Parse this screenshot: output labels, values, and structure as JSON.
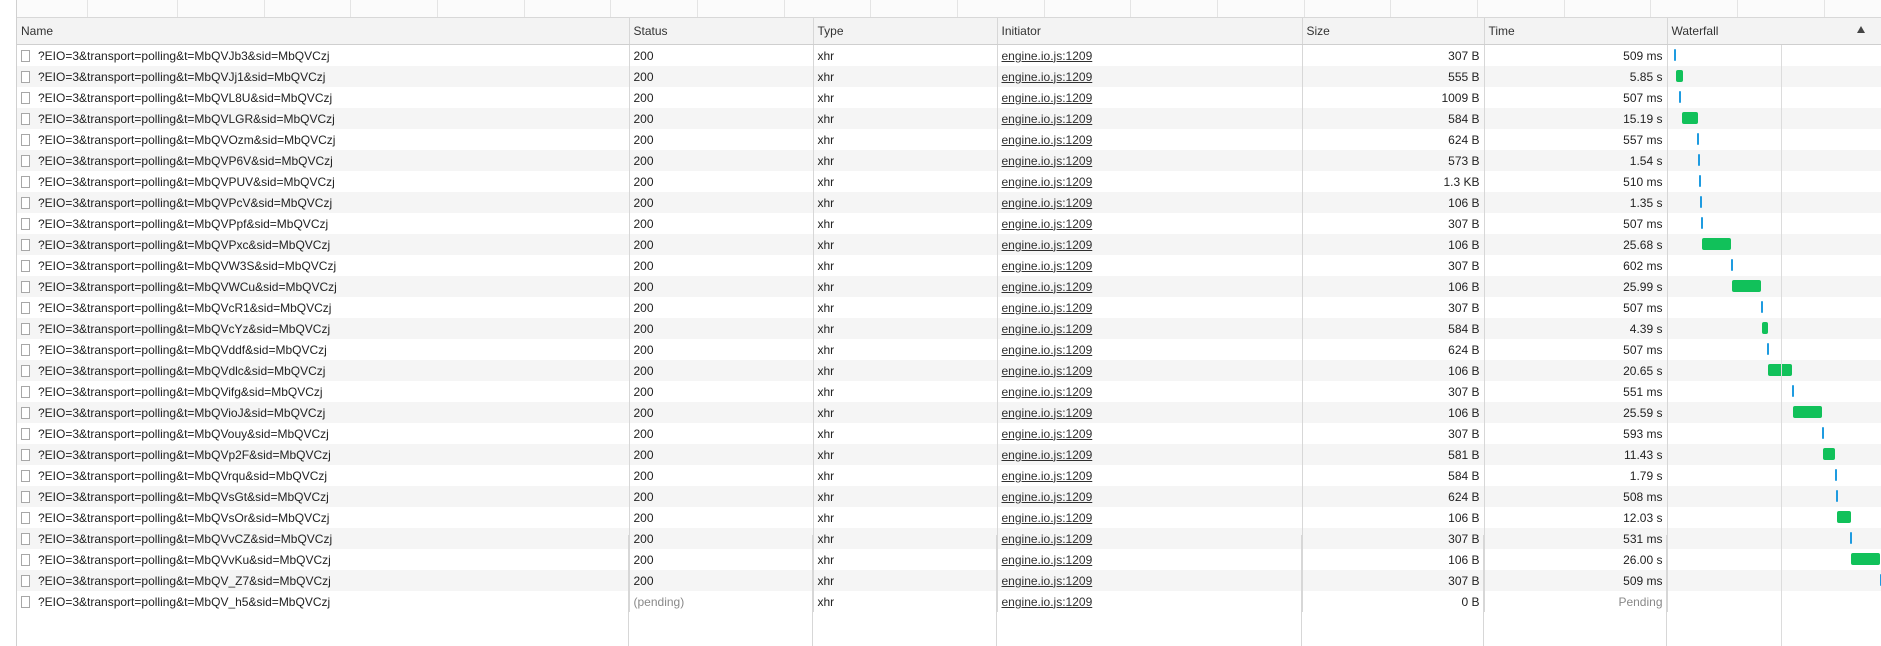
{
  "columns": {
    "name": "Name",
    "status": "Status",
    "type": "Type",
    "initiator": "Initiator",
    "size": "Size",
    "time": "Time",
    "waterfall": "Waterfall"
  },
  "waterfall_sort": "ascending",
  "colors": {
    "bar_receiving": "#11c15a",
    "bar_waiting": "#1e9be0",
    "row_alt": "#f5f5f5",
    "header_bg": "#f3f3f3"
  },
  "rows": [
    {
      "name": "?EIO=3&transport=polling&t=MbQVJb3&sid=MbQVCzj",
      "status": "200",
      "type": "xhr",
      "initiator": "engine.io.js:1209",
      "size": "307 B",
      "time": "509 ms"
    },
    {
      "name": "?EIO=3&transport=polling&t=MbQVJj1&sid=MbQVCzj",
      "status": "200",
      "type": "xhr",
      "initiator": "engine.io.js:1209",
      "size": "555 B",
      "time": "5.85 s"
    },
    {
      "name": "?EIO=3&transport=polling&t=MbQVL8U&sid=MbQVCzj",
      "status": "200",
      "type": "xhr",
      "initiator": "engine.io.js:1209",
      "size": "1009 B",
      "time": "507 ms"
    },
    {
      "name": "?EIO=3&transport=polling&t=MbQVLGR&sid=MbQVCzj",
      "status": "200",
      "type": "xhr",
      "initiator": "engine.io.js:1209",
      "size": "584 B",
      "time": "15.19 s"
    },
    {
      "name": "?EIO=3&transport=polling&t=MbQVOzm&sid=MbQVCzj",
      "status": "200",
      "type": "xhr",
      "initiator": "engine.io.js:1209",
      "size": "624 B",
      "time": "557 ms"
    },
    {
      "name": "?EIO=3&transport=polling&t=MbQVP6V&sid=MbQVCzj",
      "status": "200",
      "type": "xhr",
      "initiator": "engine.io.js:1209",
      "size": "573 B",
      "time": "1.54 s"
    },
    {
      "name": "?EIO=3&transport=polling&t=MbQVPUV&sid=MbQVCzj",
      "status": "200",
      "type": "xhr",
      "initiator": "engine.io.js:1209",
      "size": "1.3 KB",
      "time": "510 ms"
    },
    {
      "name": "?EIO=3&transport=polling&t=MbQVPcV&sid=MbQVCzj",
      "status": "200",
      "type": "xhr",
      "initiator": "engine.io.js:1209",
      "size": "106 B",
      "time": "1.35 s"
    },
    {
      "name": "?EIO=3&transport=polling&t=MbQVPpf&sid=MbQVCzj",
      "status": "200",
      "type": "xhr",
      "initiator": "engine.io.js:1209",
      "size": "307 B",
      "time": "507 ms"
    },
    {
      "name": "?EIO=3&transport=polling&t=MbQVPxc&sid=MbQVCzj",
      "status": "200",
      "type": "xhr",
      "initiator": "engine.io.js:1209",
      "size": "106 B",
      "time": "25.68 s"
    },
    {
      "name": "?EIO=3&transport=polling&t=MbQVW3S&sid=MbQVCzj",
      "status": "200",
      "type": "xhr",
      "initiator": "engine.io.js:1209",
      "size": "307 B",
      "time": "602 ms"
    },
    {
      "name": "?EIO=3&transport=polling&t=MbQVWCu&sid=MbQVCzj",
      "status": "200",
      "type": "xhr",
      "initiator": "engine.io.js:1209",
      "size": "106 B",
      "time": "25.99 s"
    },
    {
      "name": "?EIO=3&transport=polling&t=MbQVcR1&sid=MbQVCzj",
      "status": "200",
      "type": "xhr",
      "initiator": "engine.io.js:1209",
      "size": "307 B",
      "time": "507 ms"
    },
    {
      "name": "?EIO=3&transport=polling&t=MbQVcYz&sid=MbQVCzj",
      "status": "200",
      "type": "xhr",
      "initiator": "engine.io.js:1209",
      "size": "584 B",
      "time": "4.39 s"
    },
    {
      "name": "?EIO=3&transport=polling&t=MbQVddf&sid=MbQVCzj",
      "status": "200",
      "type": "xhr",
      "initiator": "engine.io.js:1209",
      "size": "624 B",
      "time": "507 ms"
    },
    {
      "name": "?EIO=3&transport=polling&t=MbQVdlc&sid=MbQVCzj",
      "status": "200",
      "type": "xhr",
      "initiator": "engine.io.js:1209",
      "size": "106 B",
      "time": "20.65 s"
    },
    {
      "name": "?EIO=3&transport=polling&t=MbQVifg&sid=MbQVCzj",
      "status": "200",
      "type": "xhr",
      "initiator": "engine.io.js:1209",
      "size": "307 B",
      "time": "551 ms"
    },
    {
      "name": "?EIO=3&transport=polling&t=MbQVioJ&sid=MbQVCzj",
      "status": "200",
      "type": "xhr",
      "initiator": "engine.io.js:1209",
      "size": "106 B",
      "time": "25.59 s"
    },
    {
      "name": "?EIO=3&transport=polling&t=MbQVouy&sid=MbQVCzj",
      "status": "200",
      "type": "xhr",
      "initiator": "engine.io.js:1209",
      "size": "307 B",
      "time": "593 ms"
    },
    {
      "name": "?EIO=3&transport=polling&t=MbQVp2F&sid=MbQVCzj",
      "status": "200",
      "type": "xhr",
      "initiator": "engine.io.js:1209",
      "size": "581 B",
      "time": "11.43 s"
    },
    {
      "name": "?EIO=3&transport=polling&t=MbQVrqu&sid=MbQVCzj",
      "status": "200",
      "type": "xhr",
      "initiator": "engine.io.js:1209",
      "size": "584 B",
      "time": "1.79 s"
    },
    {
      "name": "?EIO=3&transport=polling&t=MbQVsGt&sid=MbQVCzj",
      "status": "200",
      "type": "xhr",
      "initiator": "engine.io.js:1209",
      "size": "624 B",
      "time": "508 ms"
    },
    {
      "name": "?EIO=3&transport=polling&t=MbQVsOr&sid=MbQVCzj",
      "status": "200",
      "type": "xhr",
      "initiator": "engine.io.js:1209",
      "size": "106 B",
      "time": "12.03 s"
    },
    {
      "name": "?EIO=3&transport=polling&t=MbQVvCZ&sid=MbQVCzj",
      "status": "200",
      "type": "xhr",
      "initiator": "engine.io.js:1209",
      "size": "307 B",
      "time": "531 ms"
    },
    {
      "name": "?EIO=3&transport=polling&t=MbQVvKu&sid=MbQVCzj",
      "status": "200",
      "type": "xhr",
      "initiator": "engine.io.js:1209",
      "size": "106 B",
      "time": "26.00 s"
    },
    {
      "name": "?EIO=3&transport=polling&t=MbQV_Z7&sid=MbQVCzj",
      "status": "200",
      "type": "xhr",
      "initiator": "engine.io.js:1209",
      "size": "307 B",
      "time": "509 ms"
    },
    {
      "name": "?EIO=3&transport=polling&t=MbQV_h5&sid=MbQVCzj",
      "status": "(pending)",
      "type": "xhr",
      "initiator": "engine.io.js:1209",
      "size": "0 B",
      "time": "Pending"
    }
  ]
}
